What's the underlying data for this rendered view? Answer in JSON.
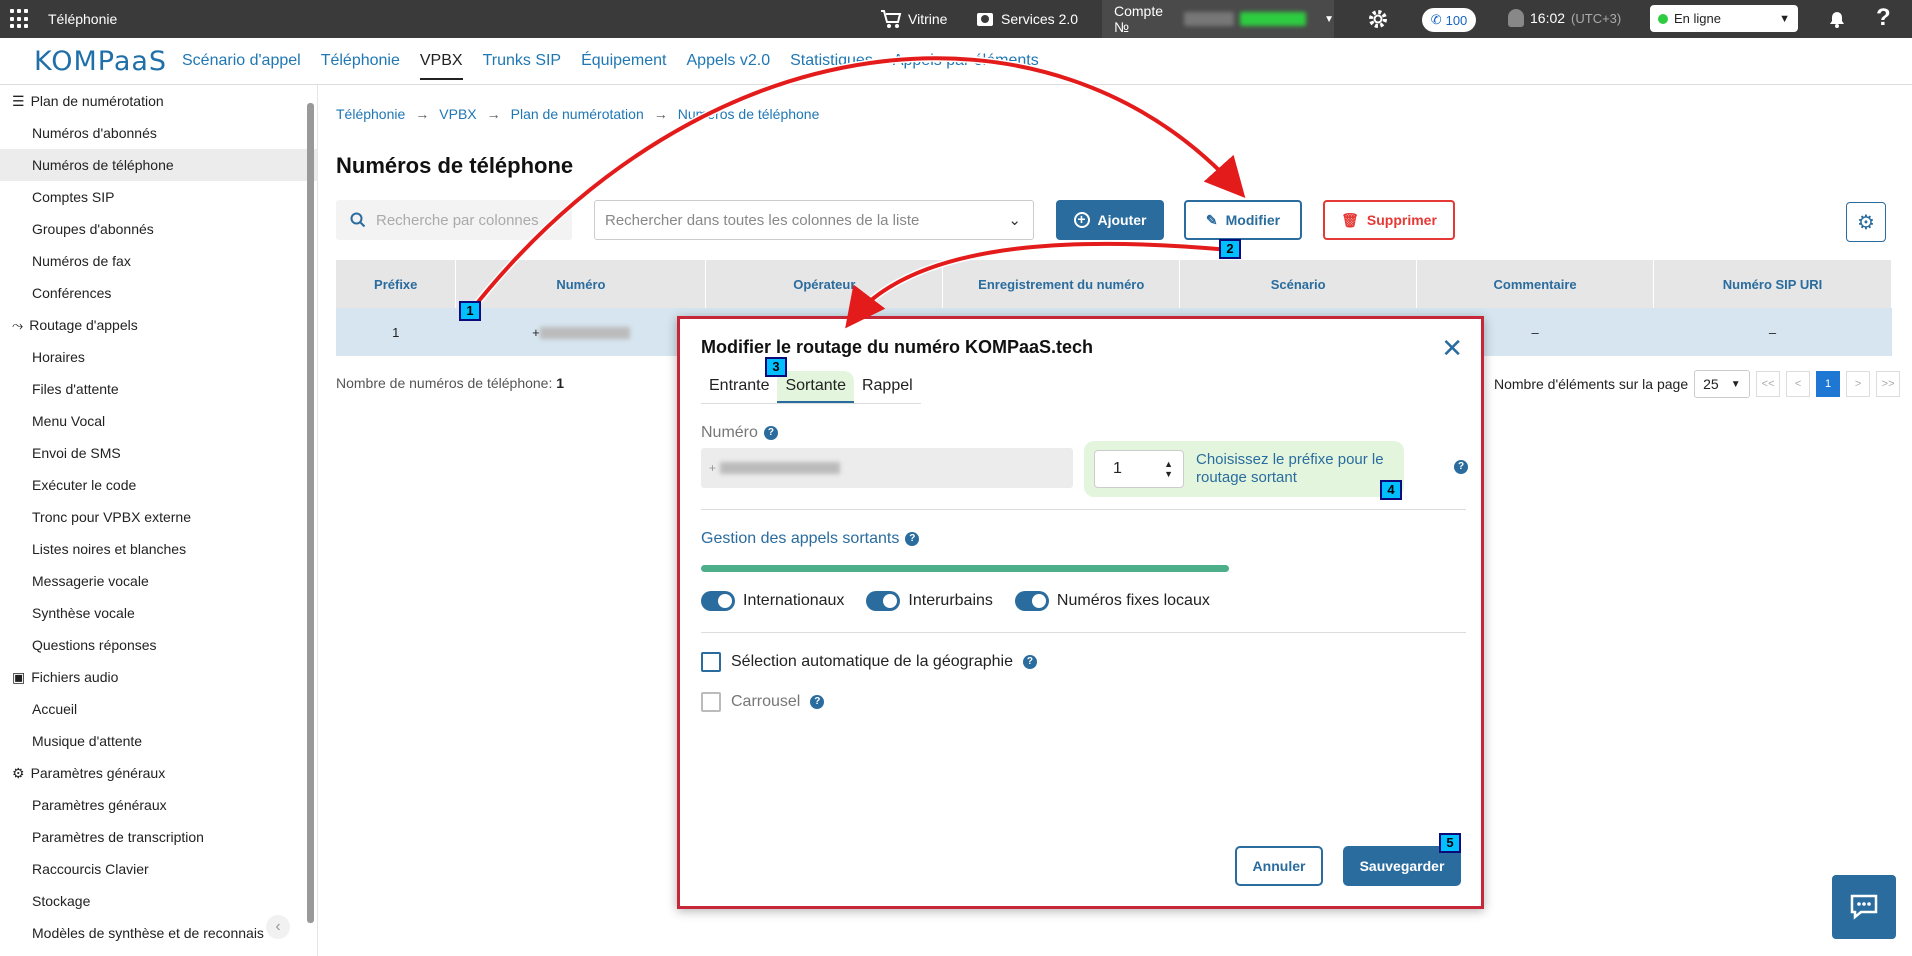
{
  "topbar": {
    "app_title": "Téléphonie",
    "vitrine": "Vitrine",
    "services": "Services 2.0",
    "account_label": "Compte №",
    "calls_count": "100",
    "time": "16:02",
    "timezone": "(UTC+3)",
    "status": "En ligne"
  },
  "nav": {
    "logo": "KOMPaaS",
    "links": [
      "Scénario d'appel",
      "Téléphonie",
      "VPBX",
      "Trunks SIP",
      "Équipement",
      "Appels v2.0",
      "Statistiques",
      "Appels par éléments"
    ]
  },
  "sidebar": {
    "sections": [
      {
        "title": "Plan de numérotation",
        "items": [
          "Numéros d'abonnés",
          "Numéros de téléphone",
          "Comptes SIP",
          "Groupes d'abonnés",
          "Numéros de fax",
          "Conférences"
        ]
      },
      {
        "title": "Routage d'appels",
        "items": [
          "Horaires",
          "Files d'attente",
          "Menu Vocal",
          "Envoi de SMS",
          "Exécuter le code",
          "Tronc pour VPBX externe",
          "Listes noires et blanches",
          "Messagerie vocale",
          "Synthèse vocale",
          "Questions réponses"
        ]
      },
      {
        "title": "Fichiers audio",
        "items": [
          "Accueil",
          "Musique d'attente"
        ]
      },
      {
        "title": "Paramètres généraux",
        "items": [
          "Paramètres généraux",
          "Paramètres de transcription",
          "Raccourcis Clavier",
          "Stockage",
          "Modèles de synthèse et de reconnais"
        ]
      }
    ]
  },
  "breadcrumb": [
    "Téléphonie",
    "VPBX",
    "Plan de numérotation",
    "Numéros de téléphone"
  ],
  "page_title": "Numéros de téléphone",
  "toolbar": {
    "search_placeholder": "Recherche par colonnes",
    "search_all_placeholder": "Rechercher dans toutes les colonnes de la liste",
    "add_label": "Ajouter",
    "edit_label": "Modifier",
    "delete_label": "Supprimer"
  },
  "table": {
    "columns": [
      "Préfixe",
      "Numéro",
      "Opérateur",
      "Enregistrement du numéro",
      "Scénario",
      "Commentaire",
      "Numéro SIP URI"
    ],
    "rows": [
      [
        "1",
        "+",
        "",
        "",
        "",
        "–",
        "–"
      ]
    ]
  },
  "footer": {
    "count_label": "Nombre de numéros de téléphone:",
    "count_value": "1",
    "per_page_label": "Nombre d'éléments sur la page",
    "per_page_value": "25",
    "pages": [
      "<<",
      "<",
      "1",
      ">",
      ">>"
    ]
  },
  "modal": {
    "title": "Modifier le routage du numéro KOMPaaS.tech",
    "tabs": [
      "Entrante",
      "Sortante",
      "Rappel"
    ],
    "numero_label": "Numéro",
    "numero_prefix": "+",
    "prefix_value": "1",
    "prefix_hint": "Choisissez le préfixe pour le routage sortant",
    "outgoing_label": "Gestion des appels sortants",
    "progress": 1.0,
    "toggles": [
      "Internationaux",
      "Interurbains",
      "Numéros fixes locaux"
    ],
    "auto_geo_label": "Sélection automatique de la géographie",
    "carousel_label": "Carrousel",
    "cancel_label": "Annuler",
    "save_label": "Sauvegarder"
  },
  "markers": [
    "1",
    "2",
    "3",
    "4",
    "5"
  ],
  "colors": {
    "accent": "#2a6c9e",
    "danger": "#e53935",
    "highlight": "#c62839",
    "marker": "#00bfff"
  }
}
